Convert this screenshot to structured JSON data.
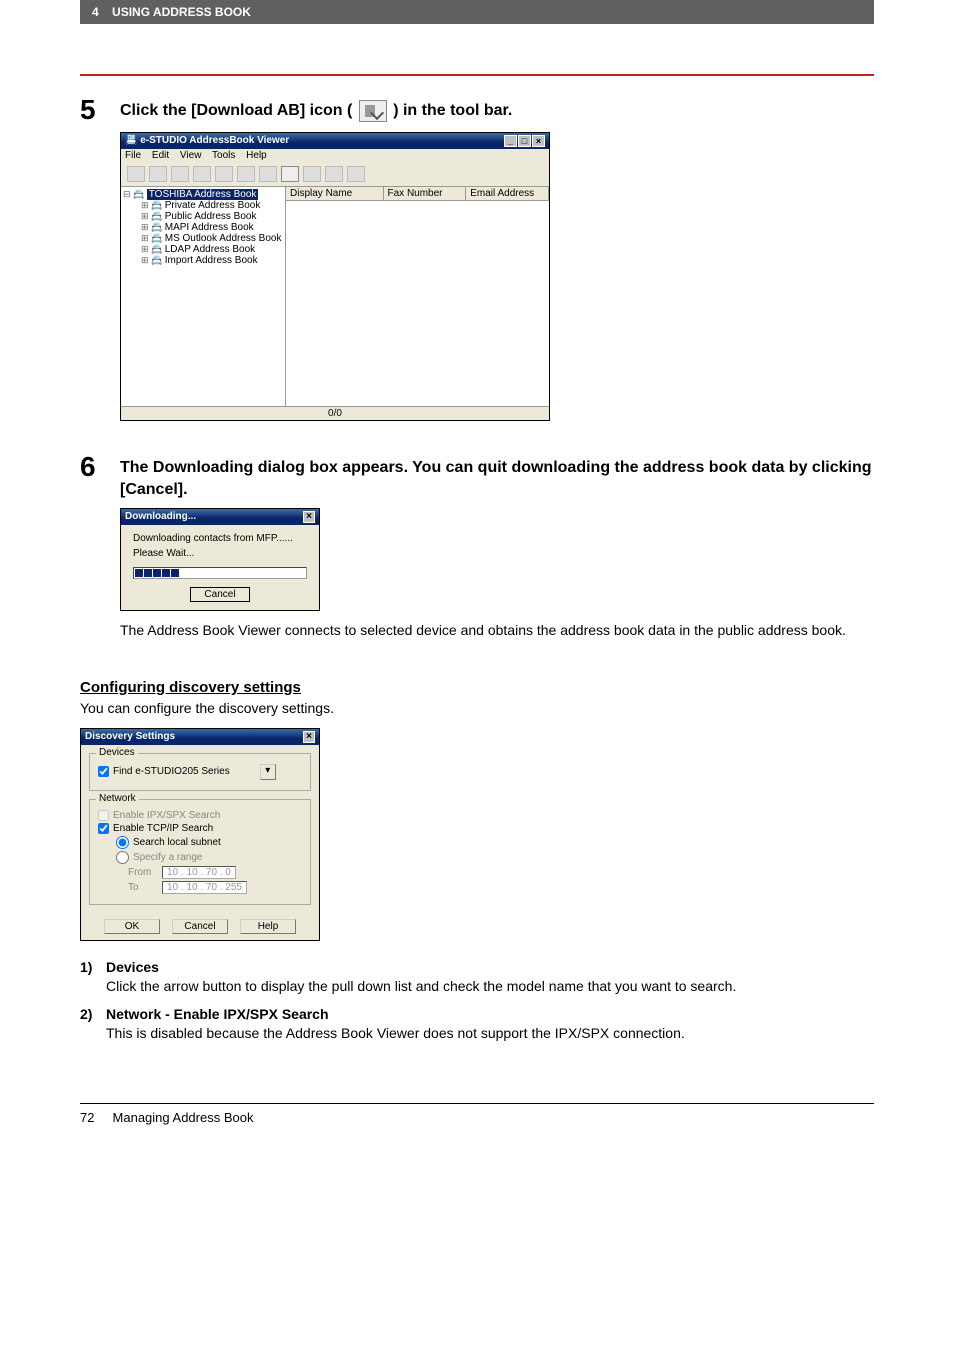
{
  "header": {
    "chapter_num": "4",
    "chapter_title": "USING ADDRESS BOOK"
  },
  "step5": {
    "number": "5",
    "text_before": "Click the [Download AB] icon (",
    "text_after": ") in the tool bar.",
    "window": {
      "title": "e-STUDIO AddressBook Viewer",
      "menu": [
        "File",
        "Edit",
        "View",
        "Tools",
        "Help"
      ],
      "tree_root": "TOSHIBA Address Book",
      "tree_items": [
        "Private Address Book",
        "Public Address Book",
        "MAPI Address Book",
        "MS Outlook Address Book",
        "LDAP Address Book",
        "Import Address Book"
      ],
      "columns": [
        "Display Name",
        "Fax Number",
        "Email Address"
      ],
      "status": "0/0"
    }
  },
  "step6": {
    "number": "6",
    "text": "The Downloading dialog box appears. You can quit downloading the address book data by clicking [Cancel].",
    "dialog": {
      "title": "Downloading...",
      "msg1": "Downloading contacts from MFP......",
      "msg2": "Please Wait...",
      "cancel": "Cancel"
    },
    "followup": "The Address Book Viewer connects to selected device and obtains the address book data in the public address book."
  },
  "discovery": {
    "heading": "Configuring discovery settings",
    "intro": "You can configure the discovery settings.",
    "dialog": {
      "title": "Discovery Settings",
      "devices_label": "Devices",
      "find_label": "Find e-STUDIO205 Series",
      "network_label": "Network",
      "enable_ipx": "Enable IPX/SPX Search",
      "enable_tcp": "Enable TCP/IP Search",
      "search_local": "Search local subnet",
      "specify_range": "Specify a range",
      "from_label": "From",
      "to_label": "To",
      "from_ip": "10 . 10 . 70 . 0",
      "to_ip": "10 . 10 . 70 . 255",
      "ok": "OK",
      "cancel": "Cancel",
      "help": "Help"
    }
  },
  "defs": [
    {
      "num": "1)",
      "term": "Devices",
      "text": "Click the arrow button to display the pull down list and check the model name that you want to search."
    },
    {
      "num": "2)",
      "term": "Network - Enable IPX/SPX Search",
      "text": "This is disabled because the Address Book Viewer does not support the IPX/SPX connection."
    }
  ],
  "footer": {
    "page": "72",
    "title": "Managing Address Book"
  }
}
